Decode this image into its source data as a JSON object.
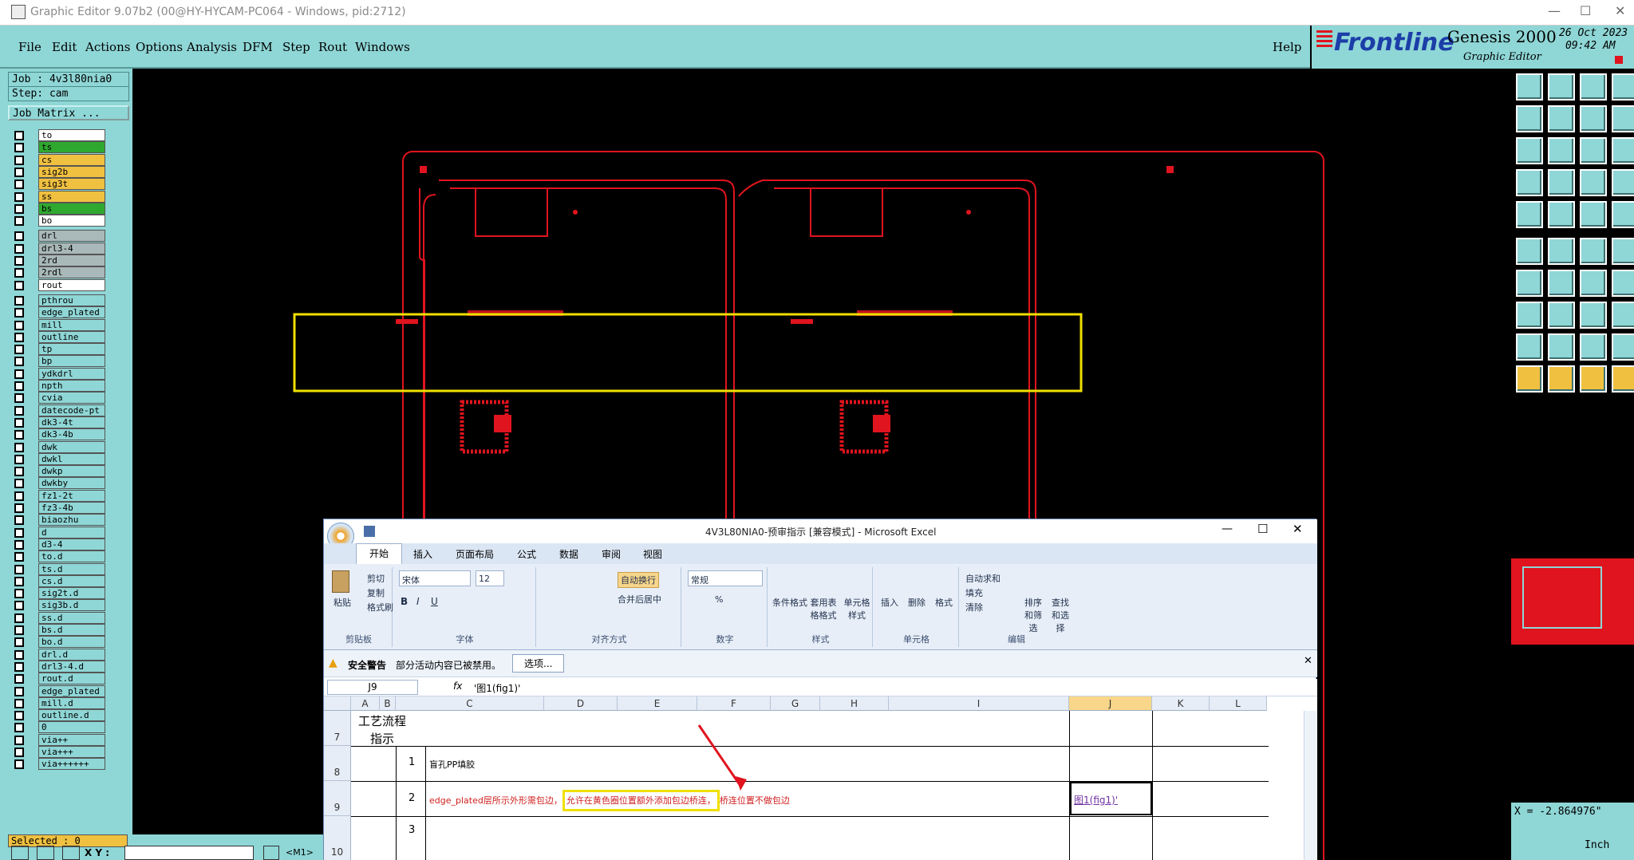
{
  "window": {
    "title": "Graphic Editor 9.07b2 (00@HY-HYCAM-PC064 - Windows, pid:2712)"
  },
  "menu": {
    "items": [
      "File",
      "Edit",
      "Actions",
      "Options",
      "Analysis",
      "DFM",
      "Step",
      "Rout",
      "Windows"
    ],
    "help": "Help"
  },
  "logo": {
    "brand": "Frontline",
    "product": "Genesis 2000",
    "subtitle": "Graphic Editor",
    "date": "26 Oct 2023",
    "time": "09:42 AM"
  },
  "job": {
    "job": "Job : 4v3l80nia0",
    "step": "Step: cam",
    "matrix": "Job Matrix ..."
  },
  "layers": [
    {
      "name": "to",
      "color": "#ffffff",
      "group": 0
    },
    {
      "name": "ts",
      "color": "#2fa82f",
      "group": 0
    },
    {
      "name": "cs",
      "color": "#f0c040",
      "group": 0
    },
    {
      "name": "sig2b",
      "color": "#f0c040",
      "group": 0
    },
    {
      "name": "sig3t",
      "color": "#f0c040",
      "group": 0
    },
    {
      "name": "ss",
      "color": "#f0c040",
      "group": 0
    },
    {
      "name": "bs",
      "color": "#2fa82f",
      "group": 0
    },
    {
      "name": "bo",
      "color": "#ffffff",
      "group": 0
    },
    {
      "name": "drl",
      "color": "#a9b8b8",
      "group": 1
    },
    {
      "name": "drl3-4",
      "color": "#a9b8b8",
      "group": 1
    },
    {
      "name": "2rd",
      "color": "#a9b8b8",
      "group": 1
    },
    {
      "name": "2rdl",
      "color": "#a9b8b8",
      "group": 1
    },
    {
      "name": "rout",
      "color": "#ffffff",
      "group": 1
    },
    {
      "name": "pthrou",
      "color": "#8fd6d6",
      "group": 2
    },
    {
      "name": "edge_plated",
      "color": "#8fd6d6",
      "group": 2
    },
    {
      "name": "mill",
      "color": "#8fd6d6",
      "group": 2
    },
    {
      "name": "outline",
      "color": "#8fd6d6",
      "group": 2
    },
    {
      "name": "tp",
      "color": "#8fd6d6",
      "group": 2
    },
    {
      "name": "bp",
      "color": "#8fd6d6",
      "group": 2
    },
    {
      "name": "ydkdrl",
      "color": "#8fd6d6",
      "group": 2
    },
    {
      "name": "npth",
      "color": "#8fd6d6",
      "group": 2
    },
    {
      "name": "cvia",
      "color": "#8fd6d6",
      "group": 2
    },
    {
      "name": "datecode-pt",
      "color": "#8fd6d6",
      "group": 2
    },
    {
      "name": "dk3-4t",
      "color": "#8fd6d6",
      "group": 2
    },
    {
      "name": "dk3-4b",
      "color": "#8fd6d6",
      "group": 2
    },
    {
      "name": "dwk",
      "color": "#8fd6d6",
      "group": 2
    },
    {
      "name": "dwkl",
      "color": "#8fd6d6",
      "group": 2
    },
    {
      "name": "dwkp",
      "color": "#8fd6d6",
      "group": 2
    },
    {
      "name": "dwkby",
      "color": "#8fd6d6",
      "group": 2
    },
    {
      "name": "fz1-2t",
      "color": "#8fd6d6",
      "group": 2
    },
    {
      "name": "fz3-4b",
      "color": "#8fd6d6",
      "group": 2
    },
    {
      "name": "biaozhu",
      "color": "#8fd6d6",
      "group": 2
    },
    {
      "name": "d",
      "color": "#8fd6d6",
      "group": 2
    },
    {
      "name": "d3-4",
      "color": "#8fd6d6",
      "group": 2
    },
    {
      "name": "to.d",
      "color": "#8fd6d6",
      "group": 2
    },
    {
      "name": "ts.d",
      "color": "#8fd6d6",
      "group": 2
    },
    {
      "name": "cs.d",
      "color": "#8fd6d6",
      "group": 2
    },
    {
      "name": "sig2t.d",
      "color": "#8fd6d6",
      "group": 2
    },
    {
      "name": "sig3b.d",
      "color": "#8fd6d6",
      "group": 2
    },
    {
      "name": "ss.d",
      "color": "#8fd6d6",
      "group": 2
    },
    {
      "name": "bs.d",
      "color": "#8fd6d6",
      "group": 2
    },
    {
      "name": "bo.d",
      "color": "#8fd6d6",
      "group": 2
    },
    {
      "name": "drl.d",
      "color": "#8fd6d6",
      "group": 2
    },
    {
      "name": "drl3-4.d",
      "color": "#8fd6d6",
      "group": 2
    },
    {
      "name": "rout.d",
      "color": "#8fd6d6",
      "group": 2
    },
    {
      "name": "edge_plated",
      "color": "#8fd6d6",
      "group": 2
    },
    {
      "name": "mill.d",
      "color": "#8fd6d6",
      "group": 2
    },
    {
      "name": "outline.d",
      "color": "#8fd6d6",
      "group": 2
    },
    {
      "name": "0",
      "color": "#8fd6d6",
      "group": 2
    },
    {
      "name": "via++",
      "color": "#8fd6d6",
      "group": 2
    },
    {
      "name": "via+++",
      "color": "#8fd6d6",
      "group": 2
    },
    {
      "name": "via++++++",
      "color": "#8fd6d6",
      "group": 2
    }
  ],
  "status": {
    "selected": "Selected : 0",
    "xy_label": "X Y :",
    "mode": "<M1>",
    "coord_x": "X = -2.864976\"",
    "units": "Inch"
  },
  "colors": {
    "cyan": "#8fd6d6",
    "board": "#e0141e",
    "highlight": "#f0e000"
  },
  "excel": {
    "title": "4V3L80NIA0-预审指示  [兼容模式] - Microsoft Excel",
    "tabs": [
      "开始",
      "插入",
      "页面布局",
      "公式",
      "数据",
      "审阅",
      "视图"
    ],
    "clipboard": {
      "paste": "粘贴",
      "cut": "剪切",
      "copy": "复制",
      "painter": "格式刷",
      "label": "剪贴板"
    },
    "font": {
      "name": "宋体",
      "size": "12",
      "label": "字体"
    },
    "align": {
      "wrap": "自动换行",
      "merge": "合并后居中",
      "label": "对齐方式"
    },
    "number": {
      "format": "常规",
      "label": "数字"
    },
    "styles": {
      "cond": "条件格式",
      "table": "套用表格格式",
      "cell": "单元格样式",
      "label": "样式"
    },
    "cells": {
      "insert": "插入",
      "delete": "删除",
      "format": "格式",
      "label": "单元格"
    },
    "edit": {
      "autosum": "自动求和",
      "fill": "填充",
      "clear": "清除",
      "sort": "排序和筛选",
      "find": "查找和选择",
      "label": "编辑"
    },
    "security": {
      "title": "安全警告",
      "message": "部分活动内容已被禁用。",
      "options": "选项..."
    },
    "namebox": "J9",
    "formula": "'图1(fig1)'",
    "columns": [
      "A",
      "B",
      "C",
      "D",
      "E",
      "F",
      "G",
      "H",
      "I",
      "J",
      "K",
      "L"
    ],
    "rows": [
      {
        "num": "7",
        "a": "工艺流程指示",
        "b": "",
        "c": "",
        "j": ""
      },
      {
        "num": "8",
        "a": "",
        "b": "1",
        "c": "盲孔PP填胶",
        "j": ""
      },
      {
        "num": "9",
        "a": "",
        "b": "2",
        "c_pre": "edge_plated层所示外形需包边，",
        "c_hl": "允许在黄色圈位置额外添加包边桥连，",
        "c_post": "桥连位置不做包边",
        "j": "图1(fig1)'"
      },
      {
        "num": "10",
        "a": "",
        "b": "3",
        "c": "",
        "j": ""
      }
    ]
  }
}
